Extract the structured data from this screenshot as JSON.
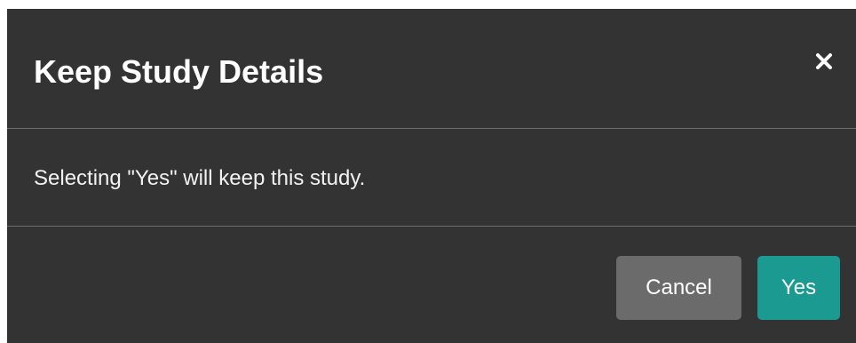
{
  "dialog": {
    "title": "Keep Study Details",
    "message": "Selecting \"Yes\" will keep this study.",
    "close_icon": "close-icon",
    "buttons": {
      "cancel_label": "Cancel",
      "yes_label": "Yes"
    },
    "colors": {
      "background": "#333333",
      "divider": "#6e6e6e",
      "cancel_button": "#6b6b6b",
      "yes_button": "#1a9a91",
      "text": "#ffffff"
    }
  }
}
